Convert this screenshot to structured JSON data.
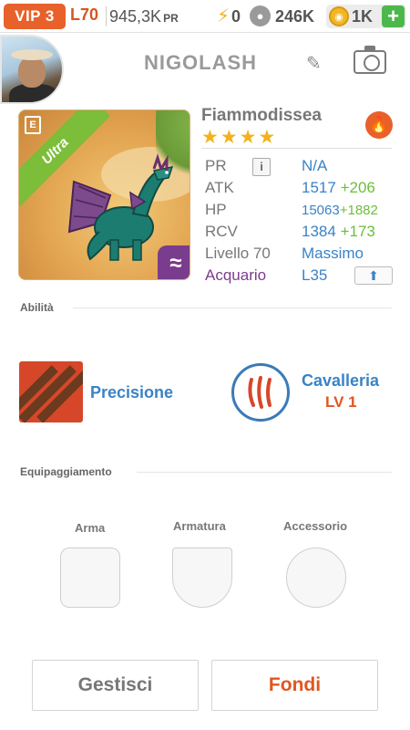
{
  "topbar": {
    "vip": "VIP 3",
    "level": "L70",
    "power": "945,3K",
    "power_unit": "PR",
    "energy": "0",
    "paw_currency": "246K",
    "gold": "1K",
    "add_label": "+",
    "icons": [
      "lightning-icon",
      "paw-icon",
      "coin-icon",
      "plus-icon"
    ]
  },
  "profile": {
    "name": "NIGOLASH",
    "icons": [
      "avatar",
      "edit-icon",
      "camera-icon"
    ]
  },
  "dragon": {
    "badge": "Ultra",
    "card_icon_letter": "E",
    "class_symbol": "≈",
    "name": "Fiammodissea",
    "element_icon": "fire-icon",
    "stars": "★★★★",
    "star_count": 4,
    "stats": {
      "pr_label": "PR",
      "pr_info": "i",
      "pr_value": "N/A",
      "atk_label": "ATK",
      "atk_value": "1517",
      "atk_bonus": "+206",
      "hp_label": "HP",
      "hp_value": "15063",
      "hp_bonus": "+1882",
      "rcv_label": "RCV",
      "rcv_value": "1384",
      "rcv_bonus": "+173",
      "level_label": "Livello 70",
      "level_value": "Massimo",
      "class_label": "Acquario",
      "class_value": "L35",
      "upgrade_icon": "arrow-up-icon"
    }
  },
  "abilities": {
    "title": "Abilità",
    "items": [
      {
        "name": "Precisione",
        "level": ""
      },
      {
        "name": "Cavalleria",
        "level": "LV 1"
      }
    ]
  },
  "equipment": {
    "title": "Equipaggiamento",
    "slots": [
      {
        "label": "Arma"
      },
      {
        "label": "Armatura"
      },
      {
        "label": "Accessorio"
      }
    ]
  },
  "actions": {
    "manage": "Gestisci",
    "merge": "Fondi"
  },
  "colors": {
    "vip": "#e8612a",
    "accent_blue": "#3a83c6",
    "bonus_green": "#6cbf3a",
    "orange": "#e0561f",
    "purple": "#7a3c8c"
  }
}
